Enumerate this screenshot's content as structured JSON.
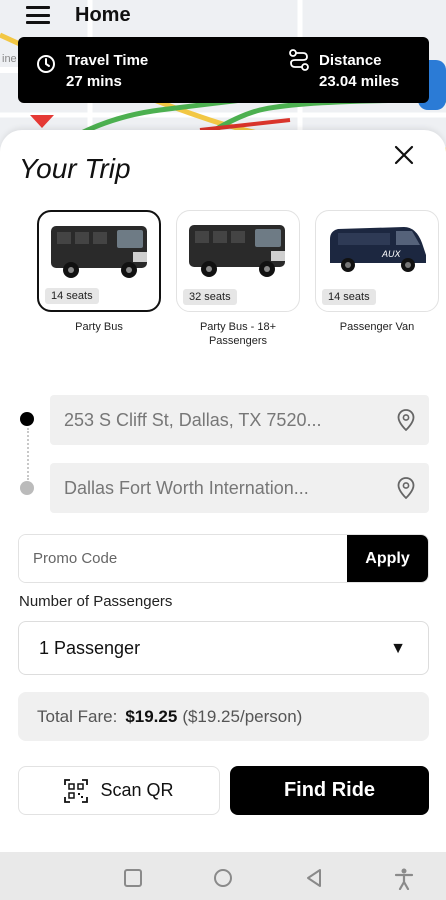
{
  "header": {
    "title": "Home",
    "menu_icon": "menu-icon"
  },
  "info": {
    "travel_label": "Travel Time",
    "travel_value": "27 mins",
    "distance_label": "Distance",
    "distance_value": "23.04 miles",
    "travel_icon": "clock-icon",
    "distance_icon": "route-icon"
  },
  "trip": {
    "title": "Your Trip",
    "close_icon": "close-icon"
  },
  "vehicles": [
    {
      "seats": "14 seats",
      "name": "Party Bus",
      "selected": true
    },
    {
      "seats": "32 seats",
      "name": "Party Bus - 18+ Passengers",
      "selected": false
    },
    {
      "seats": "14 seats",
      "name": "Passenger Van",
      "selected": false
    }
  ],
  "route": {
    "pickup": "253 S Cliff St, Dallas, TX 7520...",
    "dropoff": "Dallas Fort Worth Internation...",
    "pin_icon": "location-pin-icon"
  },
  "promo": {
    "placeholder": "Promo Code",
    "apply_label": "Apply"
  },
  "passengers": {
    "label": "Number of Passengers",
    "selected": "1 Passenger",
    "arrow": "▼"
  },
  "fare": {
    "label": "Total Fare:",
    "amount": "$19.25",
    "per_person": "($19.25/person)"
  },
  "actions": {
    "scan_label": "Scan QR",
    "find_label": "Find Ride"
  },
  "colors": {
    "primary": "#000000",
    "field_bg": "#f0f0f0",
    "map_bg": "#eef0f3"
  }
}
